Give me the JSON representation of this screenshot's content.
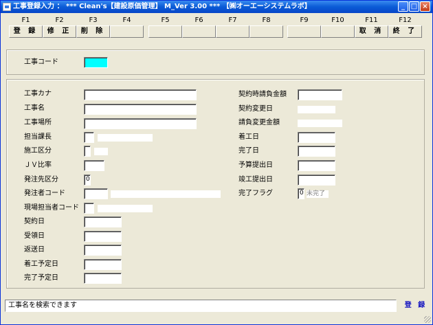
{
  "window": {
    "title": "工事登録入力 ： *** Clean's【建設原価管理】 M_Ver 3.00 *** 【㈱オーエーシステムラボ】",
    "minimize": "_",
    "maximize": "□",
    "close": "×"
  },
  "fkeys": [
    {
      "key": "F1",
      "label": "登 録"
    },
    {
      "key": "F2",
      "label": "修 正"
    },
    {
      "key": "F3",
      "label": "削 除"
    },
    {
      "key": "F4",
      "label": ""
    },
    {
      "key": "F5",
      "label": ""
    },
    {
      "key": "F6",
      "label": ""
    },
    {
      "key": "F7",
      "label": ""
    },
    {
      "key": "F8",
      "label": ""
    },
    {
      "key": "F9",
      "label": ""
    },
    {
      "key": "F10",
      "label": ""
    },
    {
      "key": "F11",
      "label": "取 消"
    },
    {
      "key": "F12",
      "label": "終 了"
    }
  ],
  "top": {
    "code_label": "工事コード",
    "code_value": ""
  },
  "left": {
    "kana_label": "工事カナ",
    "name_label": "工事名",
    "place_label": "工事場所",
    "manager_label": "担当課長",
    "construction_label": "施工区分",
    "jv_label": "ＪＶ比率",
    "order_type_label": "発注先区分",
    "order_type_value": "0",
    "orderer_label": "発注者コード",
    "site_manager_label": "現場担当者コード",
    "contract_date_label": "契約日",
    "receive_date_label": "受領日",
    "send_date_label": "返送日",
    "start_plan_label": "着工予定日",
    "finish_plan_label": "完了予定日"
  },
  "right": {
    "contract_amount_label": "契約時請負金額",
    "change_date_label": "契約変更日",
    "changed_amount_label": "請負変更金額",
    "start_label": "着工日",
    "finish_label": "完了日",
    "budget_label": "予算提出日",
    "completion_label": "竣工提出日",
    "finish_flag_label": "完了フラグ",
    "finish_flag_value": "0",
    "finish_flag_text": "未完了"
  },
  "status": {
    "message": "工事名を検索できます",
    "mode": "登 録"
  },
  "colors": {
    "title_bar": "#0a5bd6",
    "code_field": "#00ffff",
    "mode_text": "#1010c0"
  }
}
